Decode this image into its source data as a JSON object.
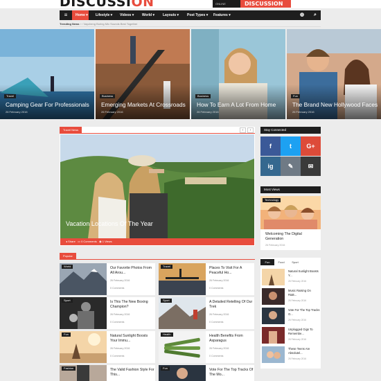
{
  "header": {
    "logo_main": "DISCUSSI",
    "logo_accent": "ON",
    "ad_text": "DISCUSSION",
    "ad_small": "ONLINE"
  },
  "nav": {
    "items": [
      "Home",
      "Lifestyle",
      "Videos",
      "World",
      "Layouts",
      "Post Types",
      "Features"
    ]
  },
  "trending": {
    "label": "Trending News",
    "text": "Vaycheng Boring Mix Sounds Best Together"
  },
  "hero": [
    {
      "tag": "Travel",
      "title": "Camping Gear For Professionals",
      "date": "26 February 2016"
    },
    {
      "tag": "Business",
      "title": "Emerging Markets At Crossroads",
      "date": "26 February 2016"
    },
    {
      "tag": "Business",
      "title": "How To Earn A Lot From Home",
      "date": "26 February 2016"
    },
    {
      "tag": "Fun",
      "title": "The Brand New Hollywood Faces",
      "date": "26 February 2016"
    }
  ],
  "travel": {
    "label": "Travel News",
    "title": "Vacation Locations Of The Year",
    "share": "Share",
    "comments": "0 Comments",
    "views": "1 Views"
  },
  "stay": {
    "label": "Stay Connected",
    "icons": [
      "f",
      "t",
      "G+",
      "ig",
      "✎",
      "✉"
    ],
    "colors": [
      "#3b5998",
      "#1da1f2",
      "#dd4b39",
      "#35688f",
      "#6f7a85",
      "#3a3a3a"
    ]
  },
  "most_views": {
    "label": "Most Views",
    "tag": "Technology",
    "title": "Welcoming The Digital Generation",
    "date": "26 February 2016"
  },
  "popular": {
    "label": "Popular",
    "items": [
      {
        "tag": "World",
        "title": "Our Favorite Photos From All Arou...",
        "date": "26 February 2016",
        "comments": "0 Comments"
      },
      {
        "tag": "Travel",
        "title": "Places To Visit For A Peaceful Ho...",
        "date": "26 February 2016",
        "comments": "0 Comments"
      },
      {
        "tag": "Sport",
        "title": "Is This The New Boxing Champion?",
        "date": "26 February 2016",
        "comments": "0 Comments"
      },
      {
        "tag": "Sport",
        "title": "A Detailed Retelling Of Our Trek",
        "date": "26 February 2016",
        "comments": "0 Comments"
      },
      {
        "tag": "Fun",
        "title": "Natural Sunlight Boosts Your Immu...",
        "date": "26 February 2016",
        "comments": "0 Comments"
      },
      {
        "tag": "Health",
        "title": "Health Benefits From Asparagus",
        "date": "26 February 2016",
        "comments": "0 Comments"
      },
      {
        "tag": "Fashion",
        "title": "The Valid Fashion Style For This...",
        "date": "26 February 2016",
        "comments": "0 Comments"
      },
      {
        "tag": "Fun",
        "title": "Vote For The Top Tracks Of The Mo...",
        "date": "26 February 2016",
        "comments": "0 Comments"
      }
    ]
  },
  "side_tabs": {
    "tabs": [
      "Fun",
      "Food",
      "Sport"
    ],
    "items": [
      {
        "title": "Natural Sunlight Boosts Y...",
        "date": "26 February 2016"
      },
      {
        "title": "Music Raising On R&B...",
        "date": "26 February 2016"
      },
      {
        "title": "Vote For The Top Tracks O...",
        "date": "26 February 2016"
      },
      {
        "title": "Unplugged Gigs To Remembe...",
        "date": "26 February 2016"
      },
      {
        "title": "These Teens Are Absolutel...",
        "date": "26 February 2016"
      }
    ]
  }
}
